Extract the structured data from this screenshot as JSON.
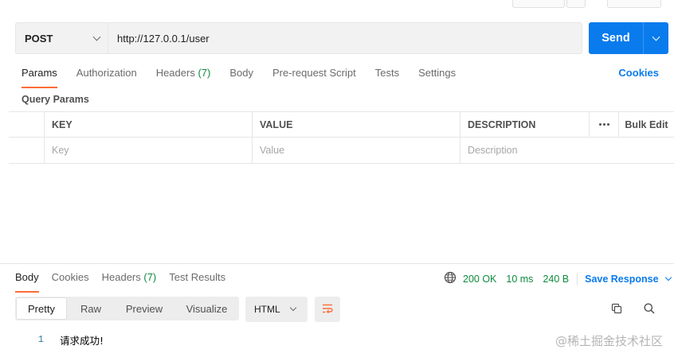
{
  "request": {
    "method": "POST",
    "url": "http://127.0.0.1/user",
    "send_label": "Send"
  },
  "request_tabs": [
    {
      "label": "Params",
      "active": true
    },
    {
      "label": "Authorization"
    },
    {
      "label": "Headers",
      "count": "(7)"
    },
    {
      "label": "Body"
    },
    {
      "label": "Pre-request Script"
    },
    {
      "label": "Tests"
    },
    {
      "label": "Settings"
    }
  ],
  "cookies_link": "Cookies",
  "query_params": {
    "title": "Query Params",
    "headers": {
      "key": "KEY",
      "value": "VALUE",
      "description": "DESCRIPTION",
      "bulk_edit": "Bulk Edit"
    },
    "placeholders": {
      "key": "Key",
      "value": "Value",
      "description": "Description"
    }
  },
  "response": {
    "tabs": [
      {
        "label": "Body",
        "active": true
      },
      {
        "label": "Cookies"
      },
      {
        "label": "Headers",
        "count": "(7)"
      },
      {
        "label": "Test Results"
      }
    ],
    "status": "200 OK",
    "time": "10 ms",
    "size": "240 B",
    "save_label": "Save Response",
    "view_modes": [
      "Pretty",
      "Raw",
      "Preview",
      "Visualize"
    ],
    "format": "HTML",
    "body_lines": [
      {
        "number": "1",
        "text": "请求成功!"
      }
    ]
  },
  "watermark": "@稀土掘金技术社区",
  "colors": {
    "accent": "#ff6c37",
    "primary": "#097bed",
    "success": "#0f8a3d"
  }
}
